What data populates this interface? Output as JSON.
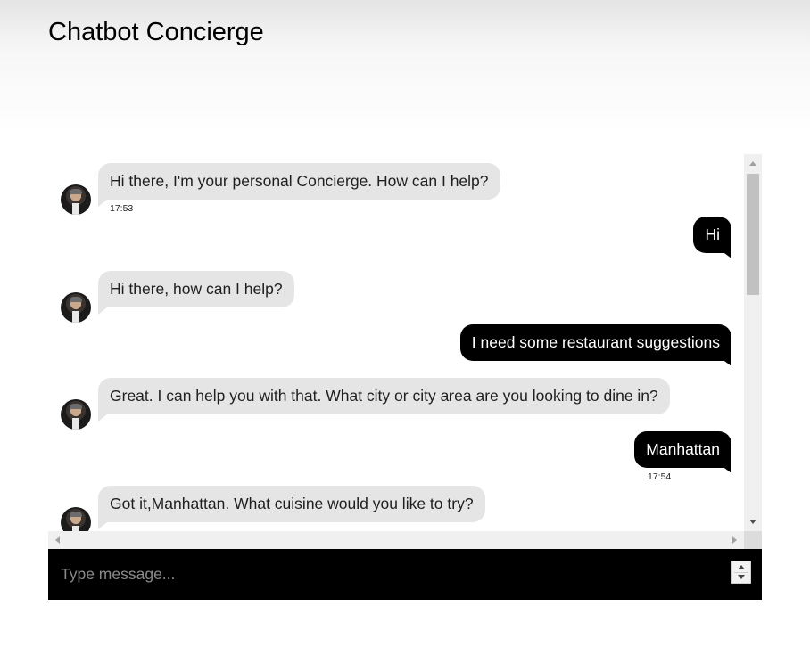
{
  "header": {
    "title": "Chatbot Concierge"
  },
  "messages": [
    {
      "sender": "bot",
      "text": "Hi there, I'm your personal Concierge. How can I help?",
      "time": "17:53"
    },
    {
      "sender": "user",
      "text": "Hi",
      "time": ""
    },
    {
      "sender": "bot",
      "text": "Hi there, how can I help?",
      "time": ""
    },
    {
      "sender": "user",
      "text": "I need some restaurant suggestions",
      "time": ""
    },
    {
      "sender": "bot",
      "text": "Great. I can help you with that. What city or city area are you looking to dine in?",
      "time": ""
    },
    {
      "sender": "user",
      "text": "Manhattan",
      "time": "17:54"
    },
    {
      "sender": "bot",
      "text": "Got it,Manhattan. What cuisine would you like to try?",
      "time": ""
    }
  ],
  "composer": {
    "placeholder": "Type message..."
  },
  "colors": {
    "user_bubble": "#000000",
    "bot_bubble": "#e5e5e5",
    "input_bar": "#000000"
  },
  "icons": {
    "avatar": "concierge-avatar",
    "scroll": "scroll-arrow-icons",
    "stepper": "number-stepper"
  }
}
